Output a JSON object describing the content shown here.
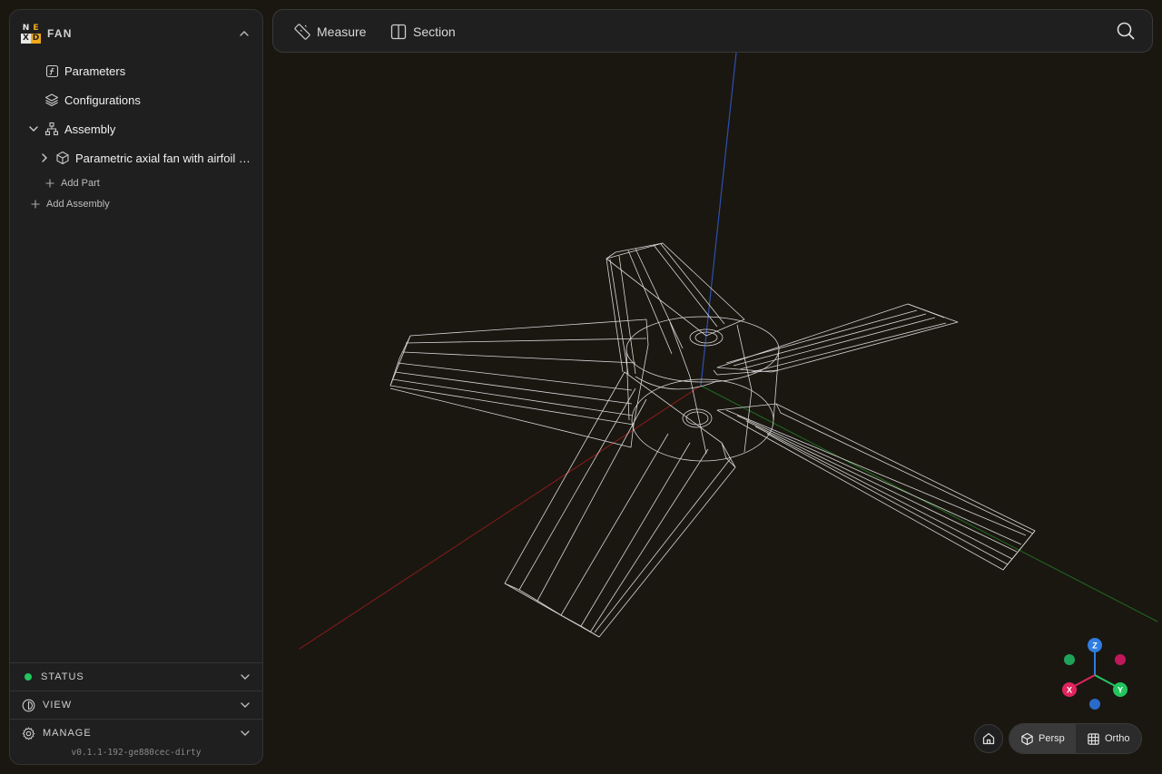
{
  "project": {
    "logo_letters": [
      "N",
      "E",
      "X",
      "D"
    ],
    "name": "FAN"
  },
  "tree": {
    "parameters_label": "Parameters",
    "configurations_label": "Configurations",
    "assembly_label": "Assembly",
    "part_label": "Parametric axial fan with airfoil …",
    "add_part_label": "Add Part",
    "add_assembly_label": "Add Assembly"
  },
  "sections": {
    "status_label": "STATUS",
    "view_label": "VIEW",
    "manage_label": "MANAGE",
    "status_color": "#22c55e"
  },
  "version": "v0.1.1-192-ge880cec-dirty",
  "toolbar": {
    "measure_label": "Measure",
    "section_label": "Section"
  },
  "view_controls": {
    "persp_label": "Persp",
    "ortho_label": "Ortho",
    "active_projection": "Persp"
  },
  "gizmo": {
    "x_label": "X",
    "y_label": "Y",
    "z_label": "Z",
    "x_color": "#e0245e",
    "y_color": "#22c55e",
    "z_color": "#2f7de1"
  },
  "axes_colors": {
    "x": "#8b1a1a",
    "y": "#1f6b1f",
    "z": "#2d4fb0"
  },
  "model_stroke": "#d6d6d6"
}
